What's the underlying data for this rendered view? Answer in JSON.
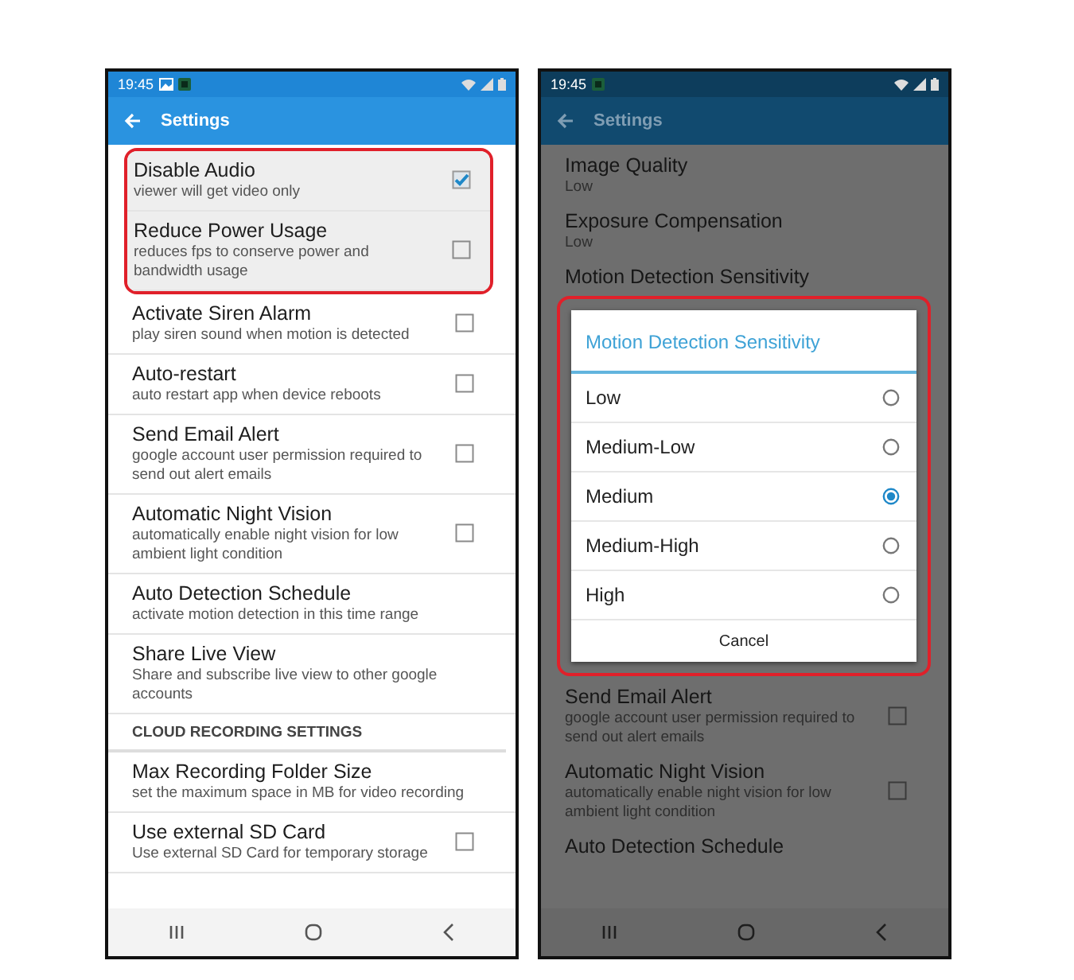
{
  "phones": [
    {
      "dimmed": false,
      "status_bar": {
        "time": "19:45",
        "notifications": [
          {
            "kind": "gallery"
          },
          {
            "kind": "app"
          }
        ]
      },
      "toolbar": {
        "title": "Settings"
      },
      "rows": [
        {
          "kind": "checkbox",
          "title": "Disable Audio",
          "subtitle": "viewer will get video only",
          "checked": true,
          "highlighted": true
        },
        {
          "kind": "checkbox",
          "title": "Reduce Power Usage",
          "subtitle": "reduces fps to conserve power and bandwidth usage",
          "checked": false,
          "highlighted": true
        },
        {
          "kind": "checkbox",
          "title": "Activate Siren Alarm",
          "subtitle": "play siren sound when motion is detected",
          "checked": false,
          "highlighted": false
        },
        {
          "kind": "checkbox",
          "title": "Auto-restart",
          "subtitle": "auto restart app when device reboots",
          "checked": false,
          "highlighted": false
        },
        {
          "kind": "checkbox",
          "title": "Send Email Alert",
          "subtitle": "google account user permission required to send out alert emails",
          "checked": false,
          "highlighted": false
        },
        {
          "kind": "checkbox",
          "title": "Automatic Night Vision",
          "subtitle": "automatically enable night vision for low ambient light condition",
          "checked": false,
          "highlighted": false
        },
        {
          "kind": "plain",
          "title": "Auto Detection Schedule",
          "subtitle": "activate motion detection in this time range",
          "highlighted": false
        },
        {
          "kind": "plain",
          "title": "Share Live View",
          "subtitle": "Share and subscribe live view to other google accounts",
          "highlighted": false
        },
        {
          "kind": "header",
          "title": "CLOUD RECORDING SETTINGS"
        },
        {
          "kind": "plain",
          "title": "Max Recording Folder Size",
          "subtitle": "set the maximum space in MB for video recording",
          "highlighted": false
        },
        {
          "kind": "checkbox",
          "title": "Use external SD Card",
          "subtitle": "Use external SD Card for temporary storage",
          "checked": false,
          "highlighted": false
        }
      ]
    },
    {
      "dimmed": true,
      "status_bar": {
        "time": "19:45",
        "notifications": [
          {
            "kind": "app"
          }
        ]
      },
      "toolbar": {
        "title": "Settings"
      },
      "rows": [
        {
          "kind": "plain",
          "title": "Image Quality",
          "subtitle": "Low",
          "highlighted": false
        },
        {
          "kind": "plain",
          "title": "Exposure Compensation",
          "subtitle": "Low",
          "highlighted": false
        },
        {
          "kind": "plain",
          "title": "Motion Detection Sensitivity",
          "highlighted": false
        },
        {
          "kind": "dialog",
          "title": "Motion Detection Sensitivity",
          "highlighted": true,
          "cancel": "Cancel",
          "options": [
            {
              "label": "Low",
              "selected": false
            },
            {
              "label": "Medium-Low",
              "selected": false
            },
            {
              "label": "Medium",
              "selected": true
            },
            {
              "label": "Medium-High",
              "selected": false
            },
            {
              "label": "High",
              "selected": false
            }
          ]
        },
        {
          "kind": "checkbox",
          "title": "Send Email Alert",
          "subtitle": "google account user permission required to send out alert emails",
          "checked": false,
          "highlighted": false
        },
        {
          "kind": "checkbox",
          "title": "Automatic Night Vision",
          "subtitle": "automatically enable night vision for low ambient light condition",
          "checked": false,
          "highlighted": false
        },
        {
          "kind": "plain",
          "title": "Auto Detection Schedule",
          "highlighted": false
        }
      ]
    }
  ]
}
